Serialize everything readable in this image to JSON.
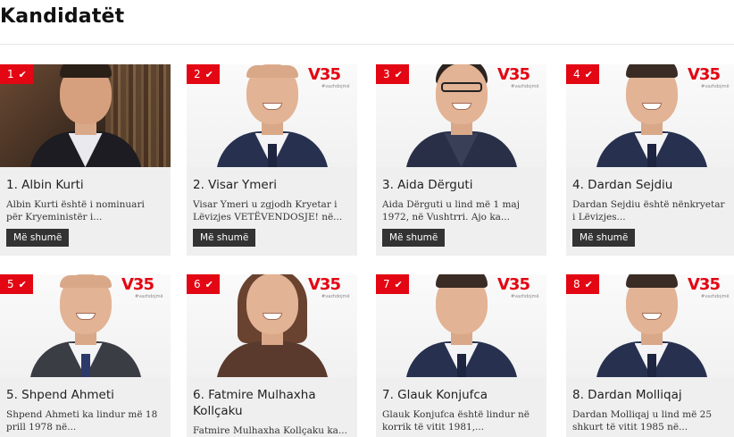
{
  "page": {
    "title": "Kandidatët"
  },
  "colors": {
    "accent": "#e30613",
    "button_bg": "#333333",
    "card_bg": "#efefef"
  },
  "logo": {
    "mark": "V35",
    "sub": "#vazhdojmë"
  },
  "candidates": [
    {
      "number": "1",
      "name": "1. Albin Kurti",
      "desc": "Albin Kurti është i nominuari për Kryeministër i...",
      "button": "Më shumë"
    },
    {
      "number": "2",
      "name": "2. Visar Ymeri",
      "desc": "Visar Ymeri u zgjodh Kryetar i Lëvizjes VETËVENDOSJE! në...",
      "button": "Më shumë"
    },
    {
      "number": "3",
      "name": "3. Aida Dërguti",
      "desc": "Aida Dërguti u lind më 1 maj 1972, në Vushtrri. Ajo ka...",
      "button": "Më shumë"
    },
    {
      "number": "4",
      "name": "4. Dardan Sejdiu",
      "desc": "Dardan Sejdiu është nënkryetar i Lëvizjes...",
      "button": "Më shumë"
    },
    {
      "number": "5",
      "name": "5. Shpend Ahmeti",
      "desc": "Shpend Ahmeti ka lindur më 18 prill 1978 në...",
      "button": ""
    },
    {
      "number": "6",
      "name": "6. Fatmire Mulhaxha Kollçaku",
      "desc": "Fatmire Mulhaxha Kollçaku ka...",
      "button": ""
    },
    {
      "number": "7",
      "name": "7. Glauk Konjufca",
      "desc": "Glauk Konjufca është lindur në korrik të vitit 1981,...",
      "button": ""
    },
    {
      "number": "8",
      "name": "8. Dardan Molliqaj",
      "desc": "Dardan Molliqaj u lind më 25 shkurt të vitit 1985 në...",
      "button": ""
    }
  ]
}
